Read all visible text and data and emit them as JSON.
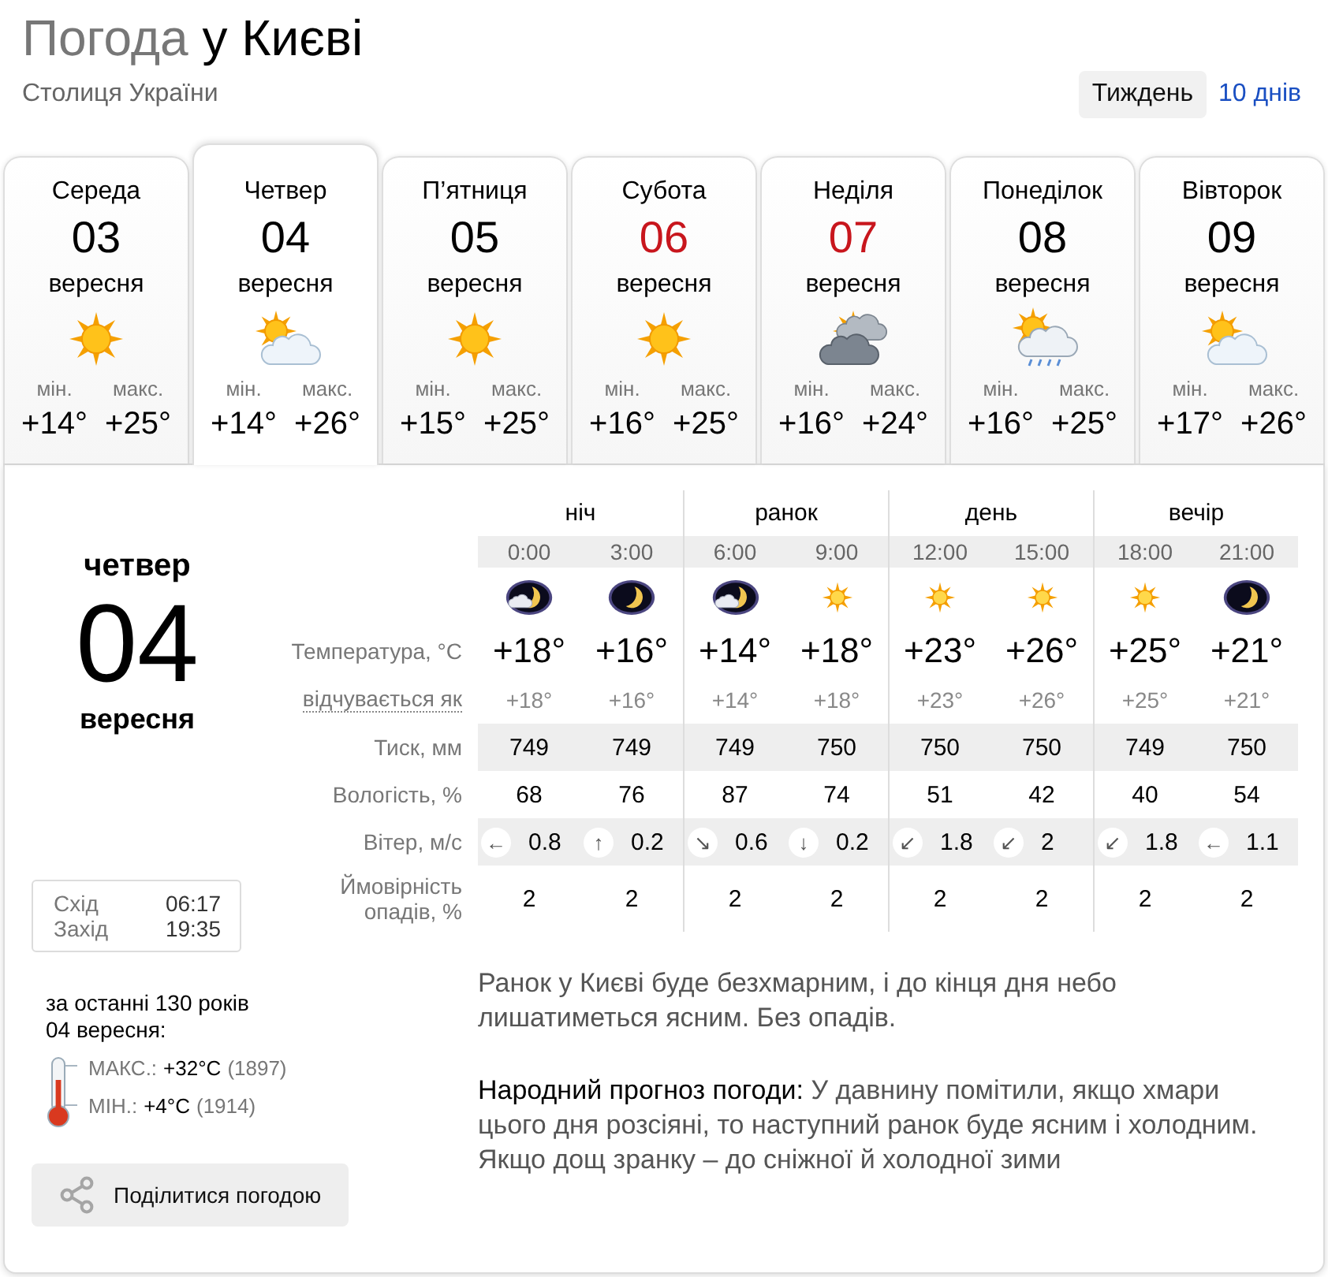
{
  "header": {
    "title_prefix": "Погода",
    "title_place": "у Києві",
    "subtitle": "Столиця України"
  },
  "range_tabs": [
    {
      "label": "Тиждень",
      "selected": true
    },
    {
      "label": "10 днів",
      "selected": false
    }
  ],
  "days": [
    {
      "weekday": "Середа",
      "date": "03",
      "month": "вересня",
      "kind": "sun",
      "min_label": "мін.",
      "min": "+14°",
      "max_label": "макс.",
      "max": "+25°",
      "weekend": false,
      "selected": false
    },
    {
      "weekday": "Четвер",
      "date": "04",
      "month": "вересня",
      "kind": "sun-cloud",
      "min_label": "мін.",
      "min": "+14°",
      "max_label": "макс.",
      "max": "+26°",
      "weekend": false,
      "selected": true
    },
    {
      "weekday": "П’ятниця",
      "date": "05",
      "month": "вересня",
      "kind": "sun",
      "min_label": "мін.",
      "min": "+15°",
      "max_label": "макс.",
      "max": "+25°",
      "weekend": false,
      "selected": false
    },
    {
      "weekday": "Субота",
      "date": "06",
      "month": "вересня",
      "kind": "sun",
      "min_label": "мін.",
      "min": "+16°",
      "max_label": "макс.",
      "max": "+25°",
      "weekend": true,
      "selected": false
    },
    {
      "weekday": "Неділя",
      "date": "07",
      "month": "вересня",
      "kind": "sun-clouds",
      "min_label": "мін.",
      "min": "+16°",
      "max_label": "макс.",
      "max": "+24°",
      "weekend": true,
      "selected": false
    },
    {
      "weekday": "Понеділок",
      "date": "08",
      "month": "вересня",
      "kind": "sun-cloud-rain",
      "min_label": "мін.",
      "min": "+16°",
      "max_label": "макс.",
      "max": "+25°",
      "weekend": false,
      "selected": false
    },
    {
      "weekday": "Вівторок",
      "date": "09",
      "month": "вересня",
      "kind": "sun-cloud",
      "min_label": "мін.",
      "min": "+17°",
      "max_label": "макс.",
      "max": "+26°",
      "weekend": false,
      "selected": false
    }
  ],
  "details": {
    "weekday": "четвер",
    "date": "04",
    "month": "вересня",
    "sun": {
      "rise_label": "Схід",
      "rise": "06:17",
      "set_label": "Захід",
      "set": "19:35"
    },
    "history": {
      "period": "за останні 130 років",
      "date": "04 вересня:",
      "records": [
        {
          "label": "МАКС.:",
          "value": "+32°C",
          "year": "(1897)"
        },
        {
          "label": "МІН.:",
          "value": "+4°C",
          "year": "(1914)"
        }
      ]
    },
    "share_button": "Поділитися погодою"
  },
  "hourly": {
    "periods": [
      "ніч",
      "ранок",
      "день",
      "вечір"
    ],
    "labels": {
      "temperature": "Температура, °C",
      "feels_like": "відчувається як",
      "pressure": "Тиск, мм",
      "humidity": "Вологість, %",
      "wind": "Вітер, м/с",
      "precipitation": "Ймовірність опадів, %"
    },
    "hours": [
      {
        "time": "0:00",
        "kind": "moon-cloud",
        "temp": "+18°",
        "feels": "+18°",
        "pressure": "749",
        "humidity": "68",
        "wind_arrow": "←",
        "wind": "0.8",
        "precipitation": "2"
      },
      {
        "time": "3:00",
        "kind": "moon",
        "temp": "+16°",
        "feels": "+16°",
        "pressure": "749",
        "humidity": "76",
        "wind_arrow": "↑",
        "wind": "0.2",
        "precipitation": "2"
      },
      {
        "time": "6:00",
        "kind": "moon-cloud",
        "temp": "+14°",
        "feels": "+14°",
        "pressure": "749",
        "humidity": "87",
        "wind_arrow": "↘",
        "wind": "0.6",
        "precipitation": "2"
      },
      {
        "time": "9:00",
        "kind": "sun",
        "temp": "+18°",
        "feels": "+18°",
        "pressure": "750",
        "humidity": "74",
        "wind_arrow": "↓",
        "wind": "0.2",
        "precipitation": "2"
      },
      {
        "time": "12:00",
        "kind": "sun",
        "temp": "+23°",
        "feels": "+23°",
        "pressure": "750",
        "humidity": "51",
        "wind_arrow": "↙",
        "wind": "1.8",
        "precipitation": "2"
      },
      {
        "time": "15:00",
        "kind": "sun",
        "temp": "+26°",
        "feels": "+26°",
        "pressure": "750",
        "humidity": "42",
        "wind_arrow": "↙",
        "wind": "2",
        "precipitation": "2"
      },
      {
        "time": "18:00",
        "kind": "sun",
        "temp": "+25°",
        "feels": "+25°",
        "pressure": "749",
        "humidity": "40",
        "wind_arrow": "↙",
        "wind": "1.8",
        "precipitation": "2"
      },
      {
        "time": "21:00",
        "kind": "moon",
        "temp": "+21°",
        "feels": "+21°",
        "pressure": "750",
        "humidity": "54",
        "wind_arrow": "←",
        "wind": "1.1",
        "precipitation": "2"
      }
    ]
  },
  "summary": "Ранок у Києві буде безхмарним, і до кінця дня небо лишатиметься ясним. Без опадів.",
  "folk_forecast": {
    "label": "Народний прогноз погоди:",
    "text": "У давнину помітили, якщо хмари цього дня розсіяні, то наступний ранок буде ясним і холодним. Якщо дощ зранку – до сніжної й холодної зими"
  }
}
